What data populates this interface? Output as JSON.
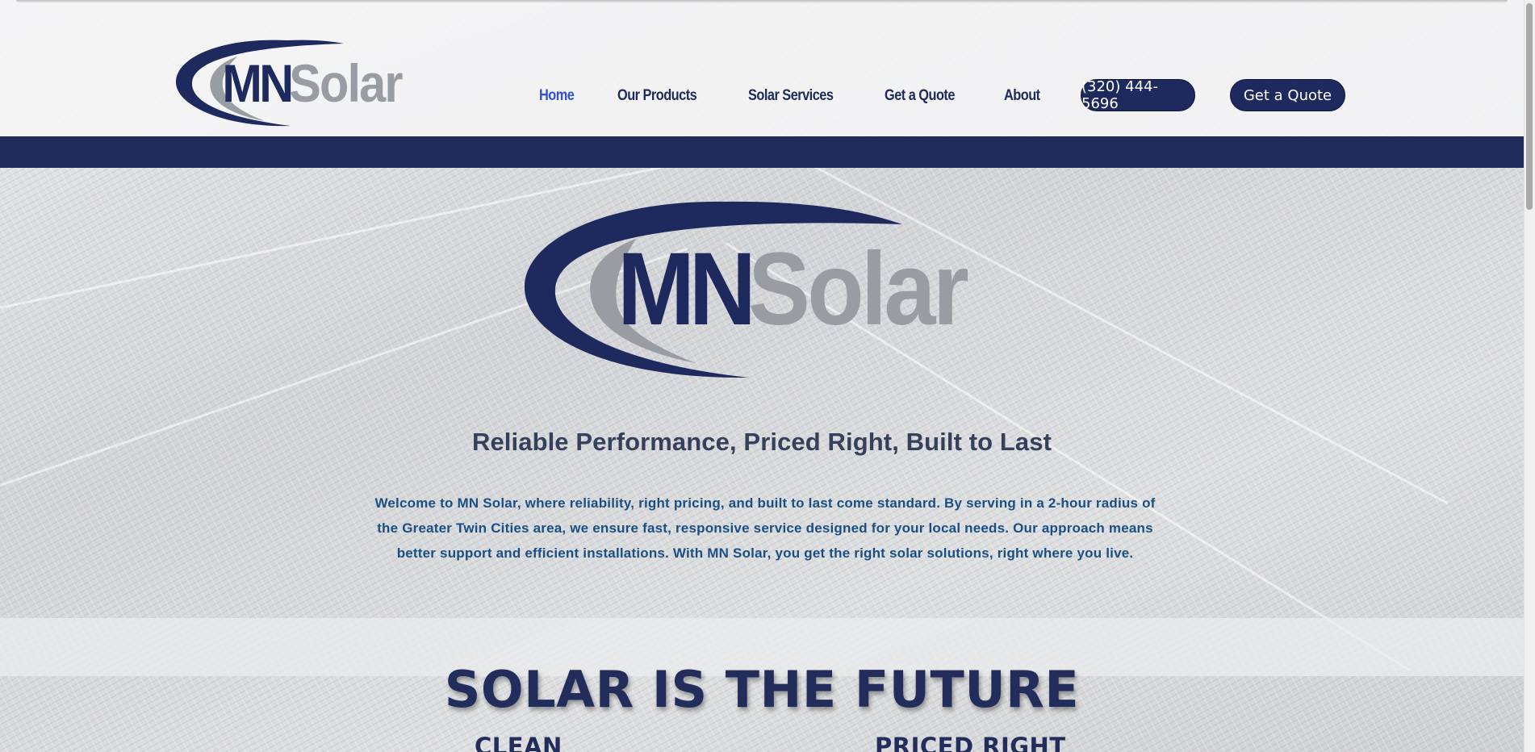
{
  "brand": {
    "logo_text_primary": "MN",
    "logo_text_secondary": "Solar",
    "colors": {
      "navy": "#1e2a5e",
      "gray": "#9a9ca3",
      "active_link": "#2f52c9",
      "welcome_text": "#1b4f83"
    }
  },
  "nav": {
    "items": [
      {
        "label": "Home",
        "active": true
      },
      {
        "label": "Our Products",
        "active": false
      },
      {
        "label": "Solar Services",
        "active": false
      },
      {
        "label": "Get a Quote",
        "active": false
      },
      {
        "label": "About",
        "active": false
      }
    ]
  },
  "header": {
    "phone_label": "(320) 444-5696",
    "quote_label": "Get a Quote"
  },
  "hero": {
    "tagline": "Reliable Performance, Priced Right, Built to Last",
    "welcome": "Welcome to MN Solar, where reliability, right pricing, and built to last come standard. By serving in a 2-hour radius of the Greater Twin Cities area, we ensure fast, responsive service designed for your local needs. Our approach means better support and efficient installations. With MN Solar, you get the right solar solutions, right where you live."
  },
  "section": {
    "title": "SOLAR IS THE FUTURE",
    "col1": "CLEAN",
    "col2": "PRICED RIGHT"
  }
}
